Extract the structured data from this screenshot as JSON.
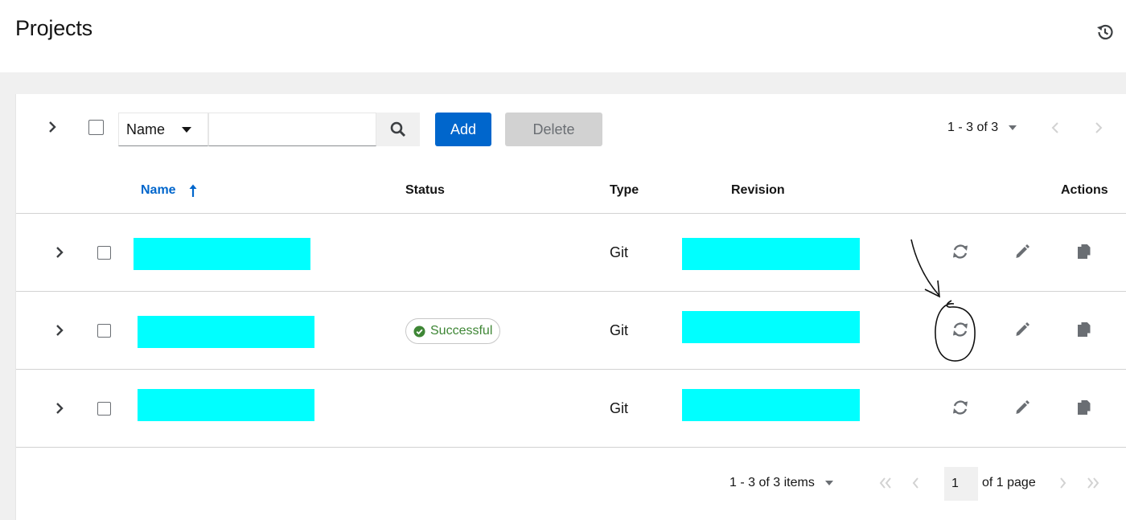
{
  "header": {
    "title": "Projects",
    "history_icon": "history-icon"
  },
  "toolbar": {
    "filter_field": "Name",
    "search_value": "",
    "add_label": "Add",
    "delete_label": "Delete",
    "pagination_label": "1 - 3 of 3"
  },
  "table": {
    "columns": {
      "name": "Name",
      "status": "Status",
      "type": "Type",
      "revision": "Revision",
      "actions": "Actions"
    },
    "sort": {
      "column": "Name",
      "direction": "ascending"
    },
    "rows": [
      {
        "name": "",
        "status": "",
        "type": "Git",
        "revision": ""
      },
      {
        "name": "",
        "status": "Successful",
        "type": "Git",
        "revision": ""
      },
      {
        "name": "",
        "status": "",
        "type": "Git",
        "revision": ""
      }
    ]
  },
  "footer": {
    "items_label": "1 - 3 of 3 items",
    "page_value": "1",
    "of_pages_label": "of 1 page"
  },
  "colors": {
    "primary": "#0066cc",
    "success": "#3e8635",
    "redaction": "#00ffff",
    "disabled": "#d2d2d2",
    "band": "#f0f0f0"
  },
  "icons": [
    "history-icon",
    "chevron-right-icon",
    "search-icon",
    "sort-up-icon",
    "check-circle-icon",
    "sync-icon",
    "pencil-icon",
    "copy-icon",
    "angle-double-left-icon",
    "angle-left-icon",
    "angle-right-icon",
    "angle-double-right-icon"
  ]
}
